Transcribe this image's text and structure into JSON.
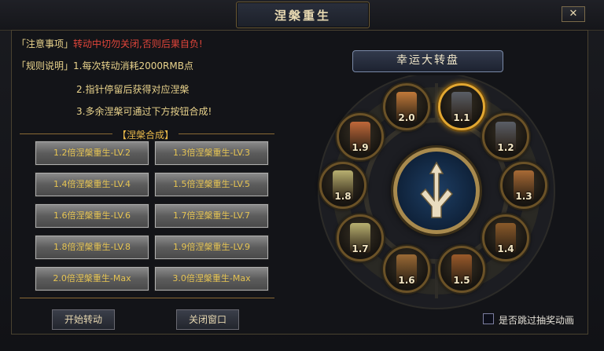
{
  "window": {
    "title": "涅槃重生",
    "close_label": "✕"
  },
  "notes": {
    "notice_tag": "「注意事项」",
    "notice_text": "转动中切勿关闭,否则后果自负!",
    "rules_tag": "「规则说明」",
    "rules": [
      "1.每次转动消耗2000RMB点",
      "2.指针停留后获得对应涅槃",
      "3.多余涅槃可通过下方按钮合成!"
    ]
  },
  "combine": {
    "section_title": "【涅槃合成】",
    "buttons": [
      "1.2倍涅槃重生-LV.2",
      "1.3倍涅槃重生-LV.3",
      "1.4倍涅槃重生-LV.4",
      "1.5倍涅槃重生-LV.5",
      "1.6倍涅槃重生-LV.6",
      "1.7倍涅槃重生-LV.7",
      "1.8倍涅槃重生-LV.8",
      "1.9倍涅槃重生-LV.9",
      "2.0倍涅槃重生-Max",
      "3.0倍涅槃重生-Max"
    ]
  },
  "actions": {
    "start_label": "开始转动",
    "close_label": "关闭窗口"
  },
  "wheel": {
    "title": "幸运大转盘",
    "nodes": [
      "2.0",
      "1.1",
      "1.2",
      "1.3",
      "1.4",
      "1.5",
      "1.6",
      "1.7",
      "1.8",
      "1.9"
    ],
    "active_node": "1.1"
  },
  "skip_animation": {
    "label": "是否跳过抽奖动画",
    "checked": false
  },
  "colors": {
    "warning_red": "#e0453a",
    "gold_text": "#e9d38c",
    "button_gold_text": "#e6c453",
    "active_ring": "#e2a731"
  }
}
